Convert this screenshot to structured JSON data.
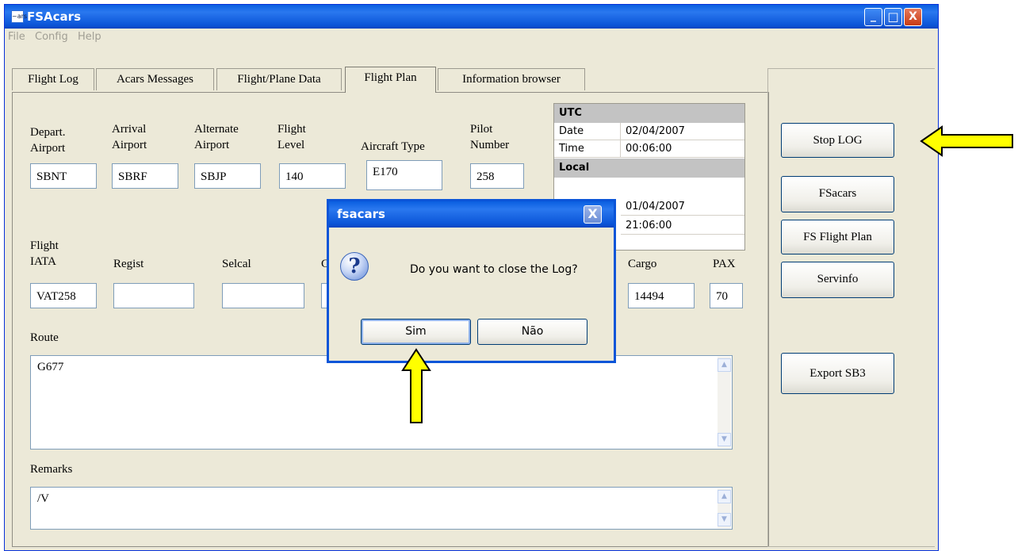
{
  "window": {
    "title": "FSAcars",
    "icon_text": "~ars",
    "controls": {
      "minimize": "_",
      "maximize": "□",
      "close": "X"
    }
  },
  "menu": [
    "File",
    "Config",
    "Help"
  ],
  "tabs": [
    "Flight Log",
    "Acars Messages",
    "Flight/Plane Data",
    "Flight Plan",
    "Information browser"
  ],
  "active_tab": "Flight Plan",
  "flight_plan": {
    "depart_label_1": "Depart.",
    "depart_label_2": "Airport",
    "depart_value": "SBNT",
    "arrival_label_1": "Arrival",
    "arrival_label_2": "Airport",
    "arrival_value": "SBRF",
    "alternate_label_1": "Alternate",
    "alternate_label_2": "Airport",
    "alternate_value": "SBJP",
    "level_label_1": "Flight",
    "level_label_2": "Level",
    "level_value": "140",
    "aircraft_label": "Aircraft Type",
    "aircraft_value": "E170",
    "pilot_label_1": "Pilot",
    "pilot_label_2": "Number",
    "pilot_value": "258",
    "flight_iata_label_1": "Flight",
    "flight_iata_label_2": "IATA",
    "flight_iata_value": "VAT258",
    "regist_label": "Regist",
    "regist_value": "",
    "selcal_label": "Selcal",
    "selcal_value": "",
    "hidden_label": "C",
    "cargo_label": "Cargo",
    "cargo_value": "14494",
    "pax_label": "PAX",
    "pax_value": "70",
    "route_label": "Route",
    "route_value": "G677",
    "remarks_label": "Remarks",
    "remarks_value": "/V"
  },
  "time_table": {
    "utc_header": "UTC",
    "utc_date_label": "Date",
    "utc_date_value": "02/04/2007",
    "utc_time_label": "Time",
    "utc_time_value": "00:06:00",
    "local_header": "Local",
    "local_date_value": "01/04/2007",
    "local_time_value": "21:06:00"
  },
  "right_buttons": [
    "Stop LOG",
    "FSacars",
    "FS Flight Plan",
    "Servinfo",
    "Export SB3"
  ],
  "dialog": {
    "title": "fsacars",
    "close": "X",
    "icon": "?",
    "message": "Do you want to close the Log?",
    "yes_label": "Sim",
    "no_label": "Não"
  },
  "scroll_up_glyph": "▲",
  "scroll_down_glyph": "▼",
  "colors": {
    "annotation_arrow": "#ffff00",
    "titlebar": "#0a5fe0",
    "window_bg": "#ece9d8"
  }
}
